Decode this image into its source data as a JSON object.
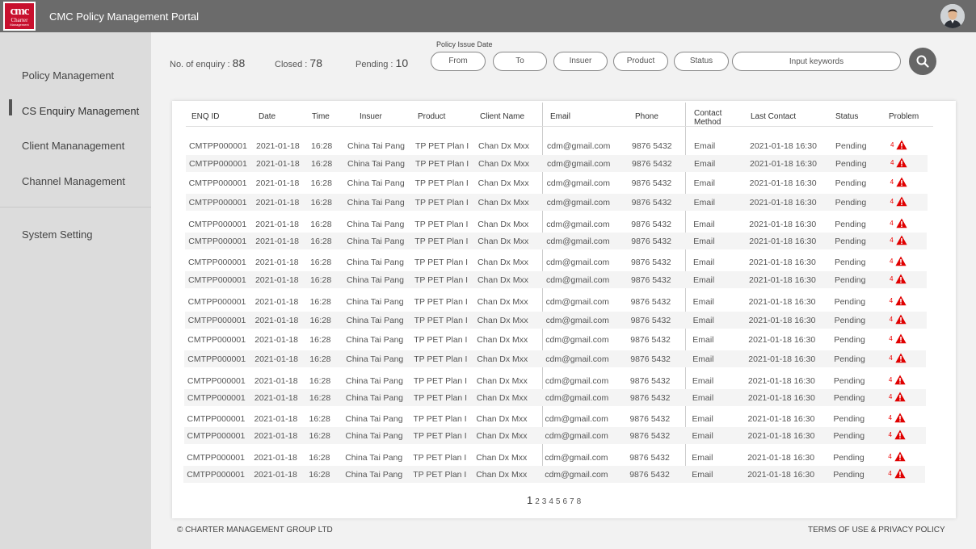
{
  "header": {
    "title": "CMC Policy Management Portal",
    "logo_lines": [
      "cmc",
      "Charter",
      "Management"
    ]
  },
  "sidebar": {
    "items": [
      {
        "label": "Policy  Management"
      },
      {
        "label": "CS Enquiry Management",
        "active": true
      },
      {
        "label": "Client Mananagement"
      },
      {
        "label": "Channel Management"
      },
      {
        "label": "System Setting"
      }
    ]
  },
  "stats": {
    "enquiry_label": "No. of enquiry : ",
    "enquiry_value": "88",
    "closed_label": "Closed : ",
    "closed_value": "78",
    "pending_label": "Pending : ",
    "pending_value": "10"
  },
  "filters": {
    "group_label": "Policy Issue Date",
    "from": "From",
    "to": "To",
    "insuer": "Insuer",
    "product": "Product",
    "status": "Status",
    "keyword_placeholder": "Input keywords"
  },
  "table": {
    "columns": [
      "ENQ ID",
      "Date",
      "Time",
      "Insuer",
      "Product",
      "Client Name",
      "Email",
      "Phone",
      "Contact Method",
      "Last Contact",
      "Status",
      "Problem"
    ],
    "rows": [
      {
        "enq_id": "CMTPP000001",
        "date": "2021-01-18",
        "time": "16:28",
        "insuer": "China Tai Pang",
        "product": "TP PET Plan I",
        "client": "Chan Dx Mxx",
        "email": "cdm@gmail.com",
        "phone": "9876 5432",
        "method": "Email",
        "last_contact": "2021-01-18  16:30",
        "status": "Pending",
        "problem": "4"
      },
      {
        "enq_id": "CMTPP000001",
        "date": "2021-01-18",
        "time": "16:28",
        "insuer": "China Tai Pang",
        "product": "TP PET Plan I",
        "client": "Chan Dx Mxx",
        "email": "cdm@gmail.com",
        "phone": "9876 5432",
        "method": "Email",
        "last_contact": "2021-01-18  16:30",
        "status": "Pending",
        "problem": "4"
      },
      {
        "enq_id": "CMTPP000001",
        "date": "2021-01-18",
        "time": "16:28",
        "insuer": "China Tai Pang",
        "product": "TP PET Plan I",
        "client": "Chan Dx Mxx",
        "email": "cdm@gmail.com",
        "phone": "9876 5432",
        "method": "Email",
        "last_contact": "2021-01-18  16:30",
        "status": "Pending",
        "problem": "4"
      },
      {
        "enq_id": "CMTPP000001",
        "date": "2021-01-18",
        "time": "16:28",
        "insuer": "China Tai Pang",
        "product": "TP PET Plan I",
        "client": "Chan Dx Mxx",
        "email": "cdm@gmail.com",
        "phone": "9876 5432",
        "method": "Email",
        "last_contact": "2021-01-18  16:30",
        "status": "Pending",
        "problem": "4"
      },
      {
        "enq_id": "CMTPP000001",
        "date": "2021-01-18",
        "time": "16:28",
        "insuer": "China Tai Pang",
        "product": "TP PET Plan I",
        "client": "Chan Dx Mxx",
        "email": "cdm@gmail.com",
        "phone": "9876 5432",
        "method": "Email",
        "last_contact": "2021-01-18  16:30",
        "status": "Pending",
        "problem": "4"
      },
      {
        "enq_id": "CMTPP000001",
        "date": "2021-01-18",
        "time": "16:28",
        "insuer": "China Tai Pang",
        "product": "TP PET Plan I",
        "client": "Chan Dx Mxx",
        "email": "cdm@gmail.com",
        "phone": "9876 5432",
        "method": "Email",
        "last_contact": "2021-01-18  16:30",
        "status": "Pending",
        "problem": "4"
      },
      {
        "enq_id": "CMTPP000001",
        "date": "2021-01-18",
        "time": "16:28",
        "insuer": "China Tai Pang",
        "product": "TP PET Plan I",
        "client": "Chan Dx Mxx",
        "email": "cdm@gmail.com",
        "phone": "9876 5432",
        "method": "Email",
        "last_contact": "2021-01-18  16:30",
        "status": "Pending",
        "problem": "4"
      },
      {
        "enq_id": "CMTPP000001",
        "date": "2021-01-18",
        "time": "16:28",
        "insuer": "China Tai Pang",
        "product": "TP PET Plan I",
        "client": "Chan Dx Mxx",
        "email": "cdm@gmail.com",
        "phone": "9876 5432",
        "method": "Email",
        "last_contact": "2021-01-18  16:30",
        "status": "Pending",
        "problem": "4"
      },
      {
        "enq_id": "CMTPP000001",
        "date": "2021-01-18",
        "time": "16:28",
        "insuer": "China Tai Pang",
        "product": "TP PET Plan I",
        "client": "Chan Dx Mxx",
        "email": "cdm@gmail.com",
        "phone": "9876 5432",
        "method": "Email",
        "last_contact": "2021-01-18  16:30",
        "status": "Pending",
        "problem": "4"
      },
      {
        "enq_id": "CMTPP000001",
        "date": "2021-01-18",
        "time": "16:28",
        "insuer": "China Tai Pang",
        "product": "TP PET Plan I",
        "client": "Chan Dx Mxx",
        "email": "cdm@gmail.com",
        "phone": "9876 5432",
        "method": "Email",
        "last_contact": "2021-01-18  16:30",
        "status": "Pending",
        "problem": "4"
      },
      {
        "enq_id": "CMTPP000001",
        "date": "2021-01-18",
        "time": "16:28",
        "insuer": "China Tai Pang",
        "product": "TP PET Plan I",
        "client": "Chan Dx Mxx",
        "email": "cdm@gmail.com",
        "phone": "9876 5432",
        "method": "Email",
        "last_contact": "2021-01-18  16:30",
        "status": "Pending",
        "problem": "4"
      },
      {
        "enq_id": "CMTPP000001",
        "date": "2021-01-18",
        "time": "16:28",
        "insuer": "China Tai Pang",
        "product": "TP PET Plan I",
        "client": "Chan Dx Mxx",
        "email": "cdm@gmail.com",
        "phone": "9876 5432",
        "method": "Email",
        "last_contact": "2021-01-18  16:30",
        "status": "Pending",
        "problem": "4"
      },
      {
        "enq_id": "CMTPP000001",
        "date": "2021-01-18",
        "time": "16:28",
        "insuer": "China Tai Pang",
        "product": "TP PET Plan I",
        "client": "Chan Dx Mxx",
        "email": "cdm@gmail.com",
        "phone": "9876 5432",
        "method": "Email",
        "last_contact": "2021-01-18  16:30",
        "status": "Pending",
        "problem": "4"
      },
      {
        "enq_id": "CMTPP000001",
        "date": "2021-01-18",
        "time": "16:28",
        "insuer": "China Tai Pang",
        "product": "TP PET Plan I",
        "client": "Chan Dx Mxx",
        "email": "cdm@gmail.com",
        "phone": "9876 5432",
        "method": "Email",
        "last_contact": "2021-01-18  16:30",
        "status": "Pending",
        "problem": "4"
      },
      {
        "enq_id": "CMTPP000001",
        "date": "2021-01-18",
        "time": "16:28",
        "insuer": "China Tai Pang",
        "product": "TP PET Plan I",
        "client": "Chan Dx Mxx",
        "email": "cdm@gmail.com",
        "phone": "9876 5432",
        "method": "Email",
        "last_contact": "2021-01-18  16:30",
        "status": "Pending",
        "problem": "4"
      },
      {
        "enq_id": "CMTPP000001",
        "date": "2021-01-18",
        "time": "16:28",
        "insuer": "China Tai Pang",
        "product": "TP PET Plan I",
        "client": "Chan Dx Mxx",
        "email": "cdm@gmail.com",
        "phone": "9876 5432",
        "method": "Email",
        "last_contact": "2021-01-18  16:30",
        "status": "Pending",
        "problem": "4"
      },
      {
        "enq_id": "CMTPP000001",
        "date": "2021-01-18",
        "time": "16:28",
        "insuer": "China Tai Pang",
        "product": "TP PET Plan I",
        "client": "Chan Dx Mxx",
        "email": "cdm@gmail.com",
        "phone": "9876 5432",
        "method": "Email",
        "last_contact": "2021-01-18  16:30",
        "status": "Pending",
        "problem": "4"
      },
      {
        "enq_id": "CMTPP000001",
        "date": "2021-01-18",
        "time": "16:28",
        "insuer": "China Tai Pang",
        "product": "TP PET Plan I",
        "client": "Chan Dx Mxx",
        "email": "cdm@gmail.com",
        "phone": "9876 5432",
        "method": "Email",
        "last_contact": "2021-01-18  16:30",
        "status": "Pending",
        "problem": "4"
      }
    ]
  },
  "pagination": {
    "pages": [
      "1",
      "2",
      "3",
      "4",
      "5",
      "6",
      "7",
      "8"
    ],
    "current": "1"
  },
  "footer": {
    "copyright": "© CHARTER MANAGEMENT GROUP LTD",
    "terms": "TERMS OF USE & PRIVACY POLICY"
  },
  "icons": {
    "search": "search-icon",
    "problem": "warning-icon",
    "avatar": "user-avatar"
  },
  "colors": {
    "topbar": "#6b6b6b",
    "sidebar": "#dcdcdc",
    "warning": "#e00000",
    "logo": "#c8102e"
  }
}
